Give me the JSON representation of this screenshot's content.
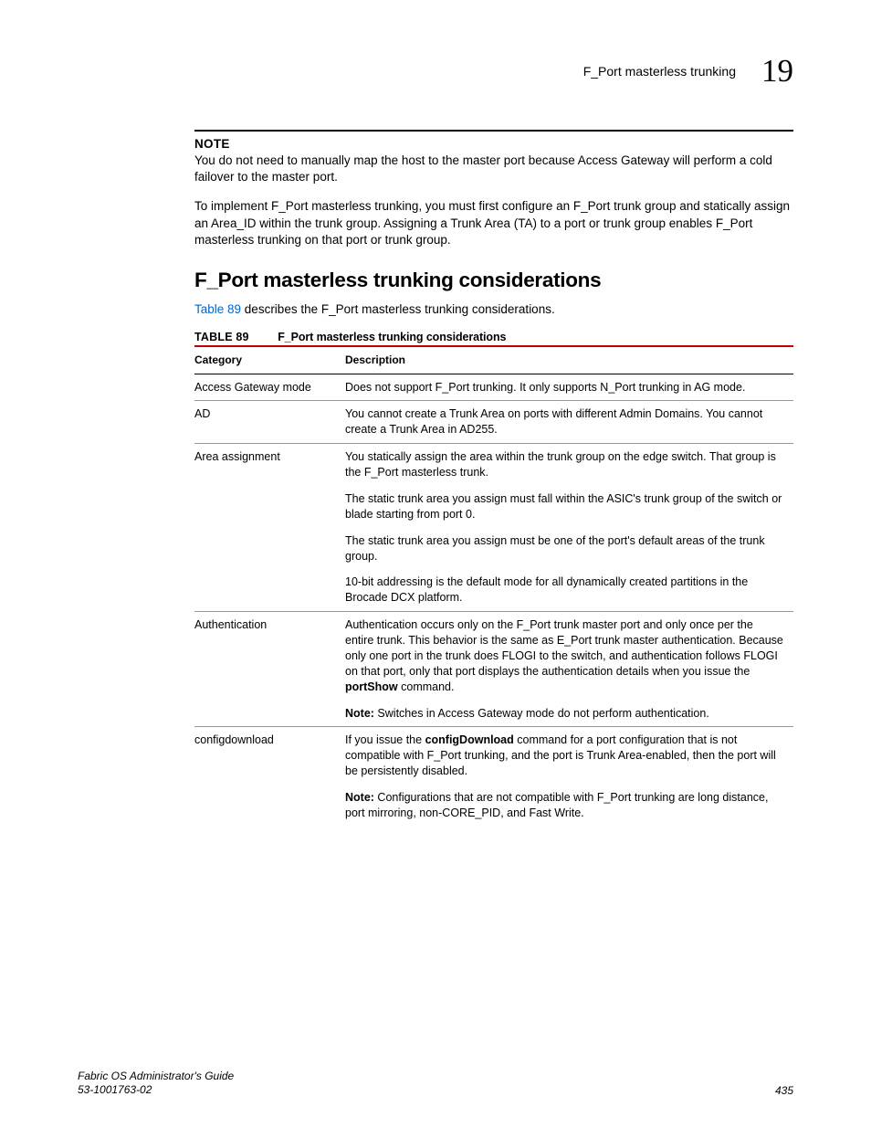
{
  "header": {
    "section_title": "F_Port masterless trunking",
    "chapter_number": "19"
  },
  "note": {
    "label": "NOTE",
    "body": "You do not need to manually map the host to the master port because Access Gateway will perform a cold failover to the master port."
  },
  "intro_para": "To implement F_Port masterless trunking, you must first configure an F_Port trunk group and statically assign an Area_ID within the trunk group. Assigning a Trunk Area (TA) to a port or trunk group enables F_Port masterless trunking on that port or trunk group.",
  "h2": "F_Port masterless trunking considerations",
  "lead": {
    "link": "Table 89",
    "rest": " describes the F_Port masterless trunking considerations."
  },
  "table": {
    "label": "TABLE 89",
    "title": "F_Port masterless trunking considerations",
    "head": {
      "c1": "Category",
      "c2": "Description"
    },
    "rows": [
      {
        "category": "Access Gateway mode",
        "paras": [
          {
            "text": "Does not support F_Port trunking. It only supports N_Port trunking in AG mode."
          }
        ]
      },
      {
        "category": "AD",
        "paras": [
          {
            "text": "You cannot create a Trunk Area on ports with different Admin Domains. You cannot create a Trunk Area in AD255."
          }
        ]
      },
      {
        "category": "Area assignment",
        "paras": [
          {
            "text": "You statically assign the area within the trunk group on the edge switch. That group is the F_Port masterless trunk."
          },
          {
            "text": "The static trunk area you assign must fall within the ASIC's trunk group of the switch or blade starting from port 0."
          },
          {
            "text": "The static trunk area you assign must be one of the port's default areas of the trunk group."
          },
          {
            "text": "10-bit addressing is the default mode for all dynamically created partitions in the Brocade DCX platform."
          }
        ]
      },
      {
        "category": "Authentication",
        "paras": [
          {
            "pre": "Authentication occurs only on the F_Port trunk master port and only once per the entire trunk. This behavior is the same as E_Port trunk master authentication. Because only one port in the trunk does FLOGI to the switch, and authentication follows FLOGI on that port, only that port displays the authentication details when you issue the ",
            "bold": "portShow",
            "post": " command."
          },
          {
            "boldlead": "Note:",
            "post": " Switches in Access Gateway mode do not perform authentication."
          }
        ]
      },
      {
        "category": "configdownload",
        "paras": [
          {
            "pre": "If you issue the ",
            "bold": "configDownload",
            "post": " command for a port configuration that is not compatible with F_Port trunking, and the port is Trunk Area-enabled, then the port will be persistently disabled."
          },
          {
            "boldlead": "Note:",
            "post": " Configurations that are not compatible with F_Port trunking are long distance, port mirroring, non-CORE_PID, and Fast Write."
          }
        ]
      }
    ]
  },
  "footer": {
    "book": "Fabric OS Administrator's Guide",
    "docnum": "53-1001763-02",
    "page": "435"
  }
}
